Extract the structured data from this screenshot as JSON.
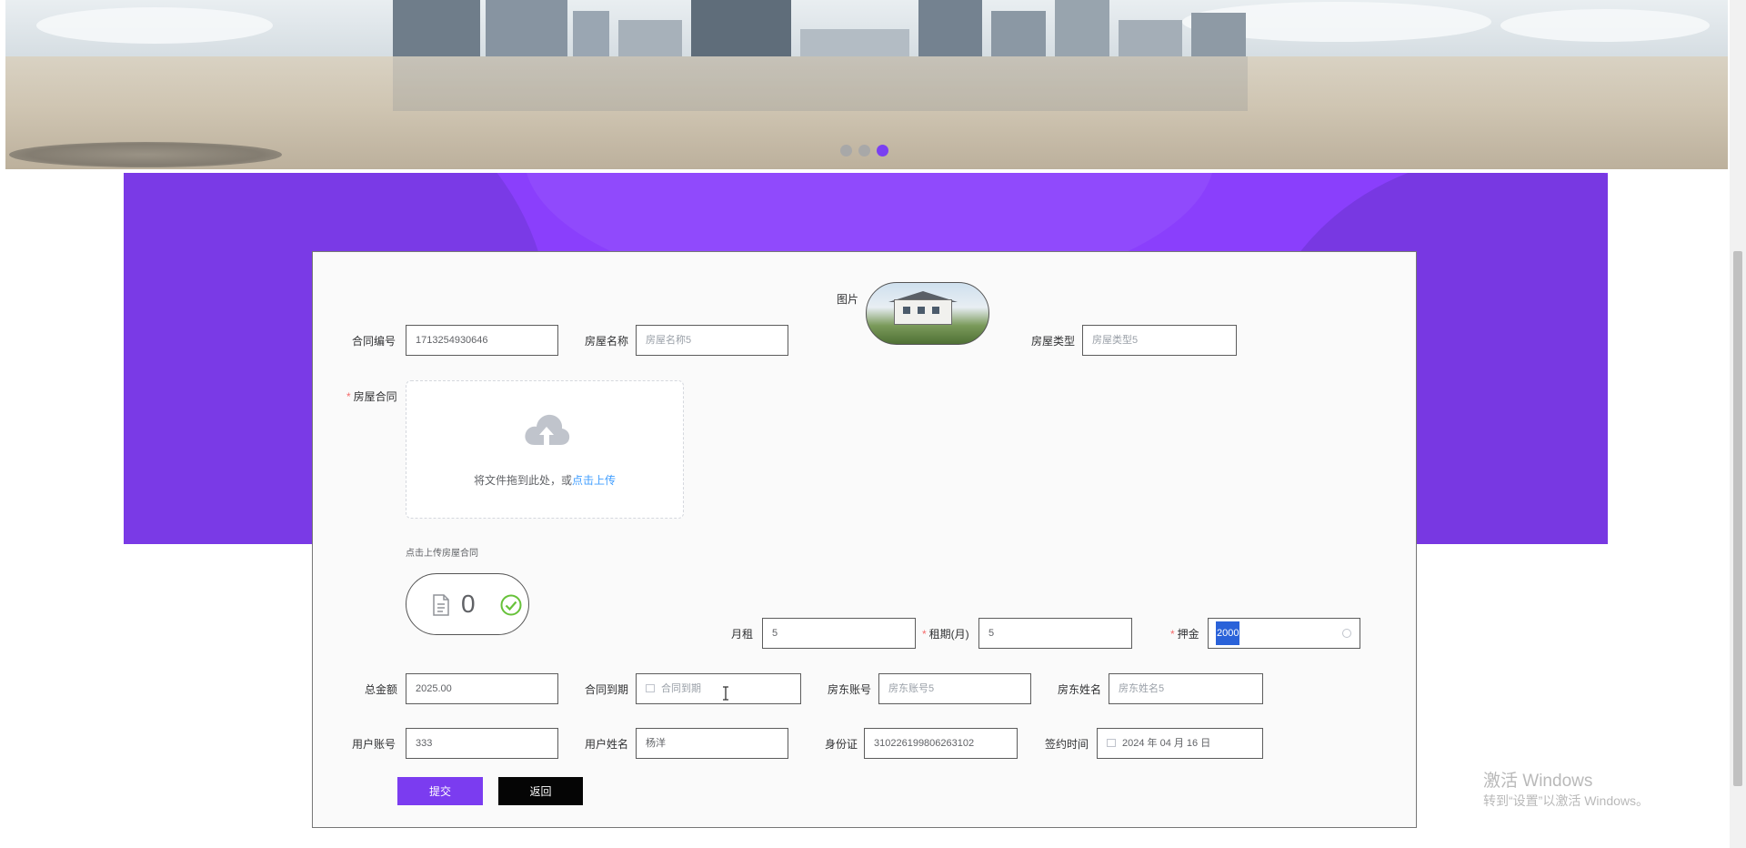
{
  "carousel": {
    "slides": 3,
    "active_index": 3
  },
  "form": {
    "picture_label": "图片",
    "contract_no": {
      "label": "合同编号",
      "value": "1713254930646"
    },
    "house_name": {
      "label": "房屋名称",
      "placeholder": "房屋名称5"
    },
    "house_type": {
      "label": "房屋类型",
      "placeholder": "房屋类型5"
    },
    "house_contract": {
      "label": "房屋合同",
      "upload_text": "将文件拖到此处，或",
      "upload_link": "点击上传",
      "tip": "点击上传房屋合同",
      "file_count": "0"
    },
    "monthly_rent": {
      "label": "月租",
      "value": "5"
    },
    "lease_months": {
      "label": "租期(月)",
      "value": "5"
    },
    "deposit": {
      "label": "押金",
      "value": "2000"
    },
    "total_amount": {
      "label": "总金额",
      "value": "2025.00"
    },
    "contract_expiry": {
      "label": "合同到期",
      "placeholder": "合同到期"
    },
    "landlord_account": {
      "label": "房东账号",
      "placeholder": "房东账号5"
    },
    "landlord_name": {
      "label": "房东姓名",
      "placeholder": "房东姓名5"
    },
    "user_account": {
      "label": "用户账号",
      "value": "333"
    },
    "user_name": {
      "label": "用户姓名",
      "value": "杨洋"
    },
    "id_card": {
      "label": "身份证",
      "value": "310226199806263102"
    },
    "sign_time": {
      "label": "签约时间",
      "value": "2024 年 04 月 16 日"
    },
    "submit_label": "提交",
    "back_label": "返回"
  },
  "watermark": {
    "line1": "激活 Windows",
    "line2": "转到“设置”以激活 Windows。"
  },
  "colors": {
    "accent": "#8a3ffc",
    "submit": "#7b3cf0",
    "back": "#050505",
    "required": "#f56c6c",
    "link": "#409eff",
    "success": "#67c23a"
  }
}
